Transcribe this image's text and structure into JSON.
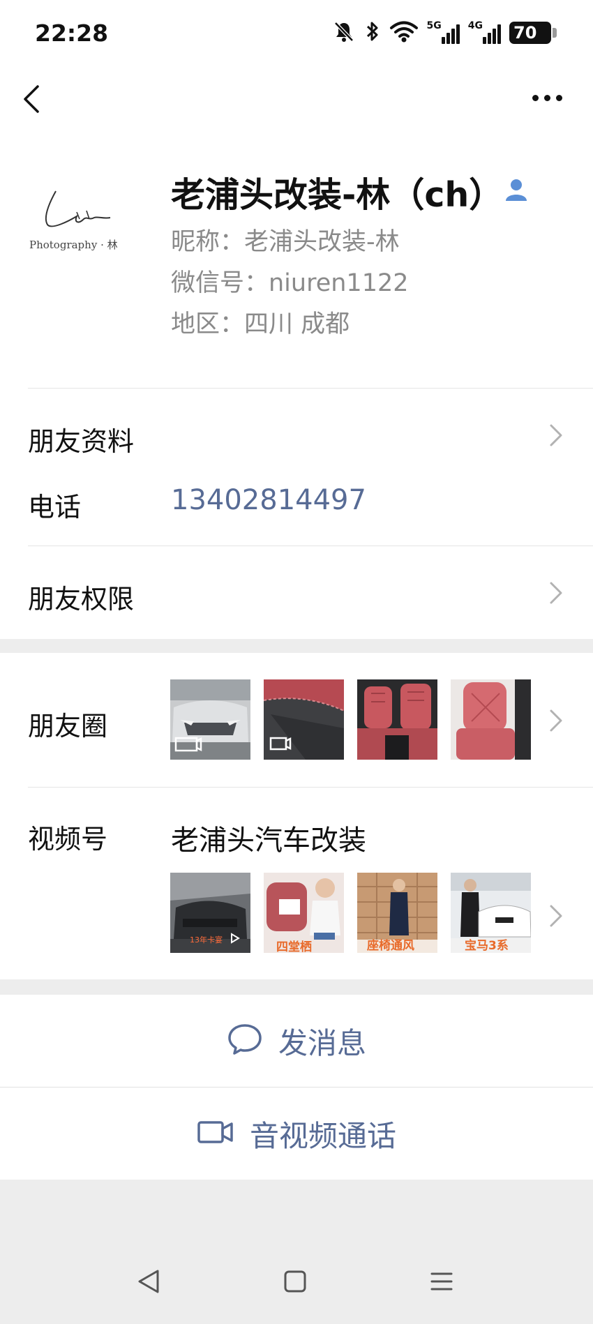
{
  "status_bar": {
    "time": "22:28",
    "network_5g": "5G",
    "network_4g": "4G",
    "battery": "70"
  },
  "profile": {
    "avatar_caption": "Photography · 林",
    "name": "老浦头改装-林（ch）",
    "nickname_text": "昵称：老浦头改装-林",
    "wechat_id_text": "微信号：niuren1122",
    "region_text": "地区：四川  成都"
  },
  "rows": {
    "friend_info_label": "朋友资料",
    "phone_label": "电话",
    "phone_value": "13402814497",
    "permissions_label": "朋友权限",
    "moments_label": "朋友圈",
    "channels_label": "视频号",
    "channel_name": "老浦头汽车改装"
  },
  "channel_thumbs": {
    "thumb1_caption": "13年卡宴",
    "thumb2_caption": "四堂栖",
    "thumb3_caption": "座椅通风",
    "thumb4_caption": "宝马3系"
  },
  "actions": {
    "message_label": "发消息",
    "call_label": "音视频通话"
  },
  "colors": {
    "link_blue": "#576b95",
    "background": "#ededed",
    "card": "#ffffff",
    "verify_icon": "#5b8fd6",
    "caption_orange": "#e86a2a"
  },
  "icons": {
    "back": "chevron-left-icon",
    "more": "more-dots-icon",
    "verify": "person-icon",
    "message": "chat-bubble-icon",
    "call": "video-camera-icon"
  }
}
